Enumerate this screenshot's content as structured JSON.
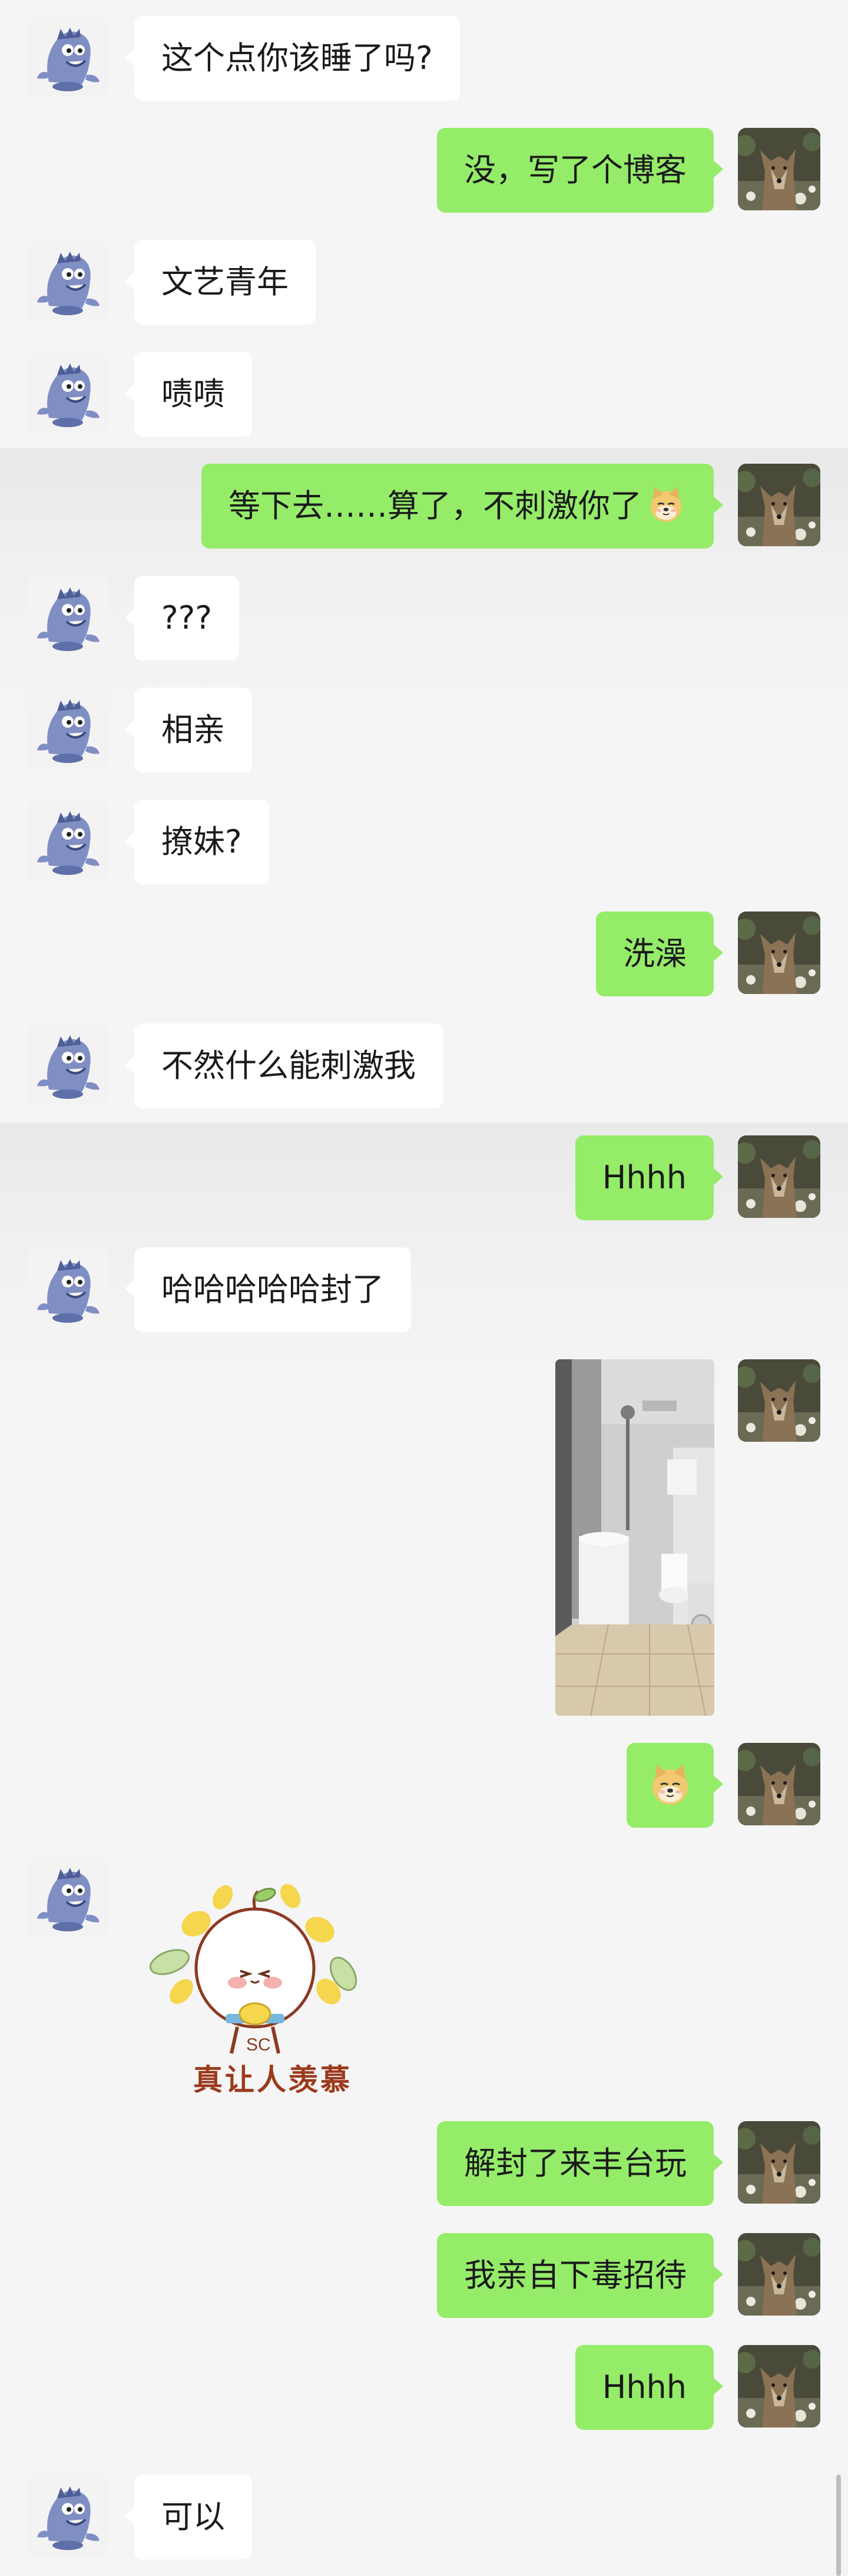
{
  "messages": [
    {
      "side": "left",
      "text": "这个点你该睡了吗?"
    },
    {
      "side": "right",
      "text": "没，写了个博客"
    },
    {
      "side": "left",
      "text": "文艺青年"
    },
    {
      "side": "left",
      "text": "啧啧"
    },
    {
      "side": "right",
      "text": "等下去……算了，不刺激你了",
      "emoji": "doge-emoji"
    },
    {
      "side": "left",
      "text": "???"
    },
    {
      "side": "left",
      "text": "相亲"
    },
    {
      "side": "left",
      "text": "撩妹?"
    },
    {
      "side": "right",
      "text": "洗澡"
    },
    {
      "side": "left",
      "text": "不然什么能刺激我"
    },
    {
      "side": "right",
      "text": "Hhhh"
    },
    {
      "side": "left",
      "text": "哈哈哈哈哈封了"
    },
    {
      "side": "right",
      "type": "photo",
      "content": "bathroom-photo"
    },
    {
      "side": "right",
      "type": "emoji",
      "emoji": "doge-emoji"
    },
    {
      "side": "left",
      "type": "sticker",
      "caption": "真让人羡慕"
    },
    {
      "side": "right",
      "text": "解封了来丰台玩"
    },
    {
      "side": "right",
      "text": "我亲自下毒招待"
    },
    {
      "side": "right",
      "text": "Hhhh"
    },
    {
      "side": "left",
      "text": "可以"
    }
  ],
  "colors": {
    "background": "#f5f5f5",
    "bubble_self": "#95ec69",
    "bubble_other": "#ffffff",
    "text": "#1a1a1a"
  },
  "avatars": {
    "other": "shark-avatar",
    "self": "wolf-avatar"
  }
}
